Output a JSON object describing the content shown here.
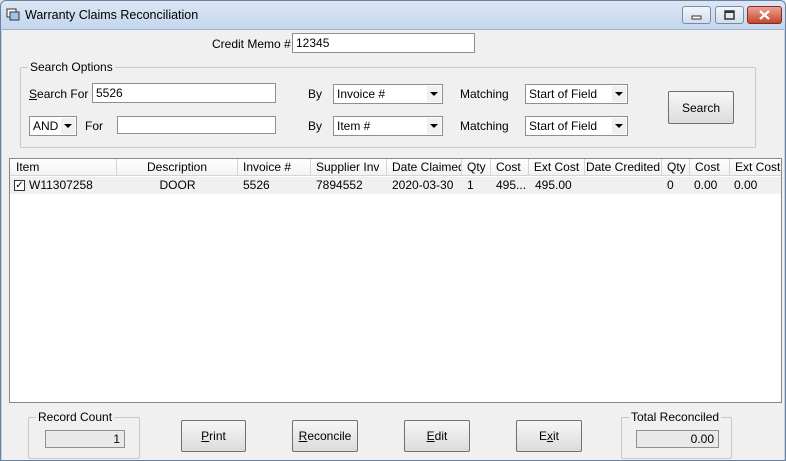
{
  "window": {
    "title": "Warranty Claims Reconciliation"
  },
  "credit_memo": {
    "label": "Credit Memo #",
    "value": "12345"
  },
  "search_options": {
    "title": "Search Options",
    "search_for_label": "Search For",
    "search_for_value": "5526",
    "by_label": "By",
    "by_value_1": "Invoice #",
    "matching_label": "Matching",
    "matching_value_1": "Start of Field",
    "conj_value": "AND",
    "for_label": "For",
    "for_value": "",
    "by_label_2": "By",
    "by_value_2": "Item #",
    "matching_label_2": "Matching",
    "matching_value_2": "Start of Field",
    "search_button": "Search"
  },
  "grid": {
    "columns": [
      "Item",
      "Description",
      "Invoice #",
      "Supplier Inv",
      "Date Claimed",
      "Qty",
      "Cost",
      "Ext Cost",
      "Date Credited",
      "Qty",
      "Cost",
      "Ext Cost"
    ],
    "rows": [
      {
        "checked": true,
        "item": "W11307258",
        "description": "DOOR",
        "invoice": "5526",
        "supplier_inv": "7894552",
        "date_claimed": "2020-03-30",
        "qty": "1",
        "cost": "495...",
        "ext_cost": "495.00",
        "date_credited": "",
        "qty2": "0",
        "cost2": "0.00",
        "ext_cost2": "0.00"
      }
    ]
  },
  "footer": {
    "record_count_label": "Record Count",
    "record_count_value": "1",
    "print_button": "Print",
    "reconcile_button": "Reconcile",
    "edit_button": "Edit",
    "exit_button": "Exit",
    "total_reconciled_label": "Total Reconciled",
    "total_reconciled_value": "0.00"
  }
}
